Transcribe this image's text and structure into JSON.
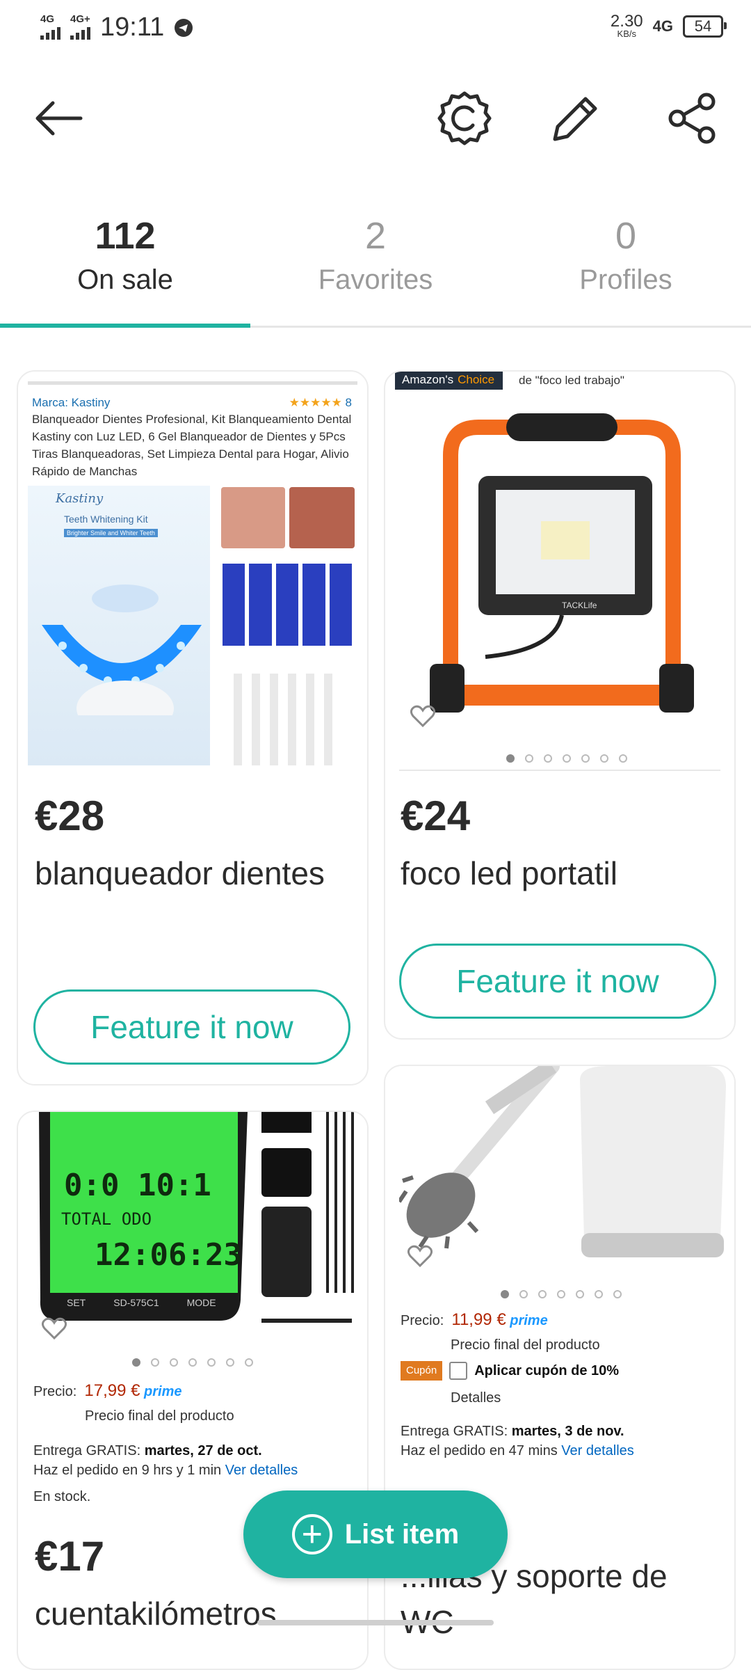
{
  "status_bar": {
    "network1": "4G",
    "network2": "4G+",
    "time": "19:11",
    "speed_value": "2.30",
    "speed_unit": "KB/s",
    "network_right": "4G",
    "battery": "54"
  },
  "header": {
    "back_icon": "arrow-left-icon",
    "boost_icon": "badge-gear-icon",
    "edit_icon": "pencil-icon",
    "share_icon": "share-icon"
  },
  "tabs": [
    {
      "count": "112",
      "label": "On sale"
    },
    {
      "count": "2",
      "label": "Favorites"
    },
    {
      "count": "0",
      "label": "Profiles"
    }
  ],
  "listings": [
    {
      "price": "€28",
      "title": "blanqueador dientes",
      "button": "Feature it now",
      "image_text": {
        "brand": "Marca: Kastiny",
        "rating_count": "8",
        "description": "Blanqueador Dientes Profesional, Kit Blanqueamiento Dental Kastiny con Luz LED, 6 Gel Blanqueador de Dientes y 5Pcs Tiras Blanqueadoras, Set Limpieza Dental para Hogar, Alivio Rápido de Manchas",
        "logo": "Kastiny",
        "kit_label": "Teeth Whitening Kit",
        "kit_sub": "Brighter Smile and Whiter Teeth"
      }
    },
    {
      "price": "€24",
      "title": "foco led portatil",
      "button": "Feature it now",
      "image_text": {
        "badge_left": "Amazon's",
        "badge_right": "Choice",
        "badge_for": "de \"foco led trabajo\"",
        "brand": "TACKLife"
      }
    },
    {
      "price": "€17",
      "title": "cuentakilómetros",
      "image_text": {
        "display_line1": "0:0 10:1",
        "display_line2": "TOTAL ODO",
        "display_line3": "12:06:23",
        "btn_set": "SET",
        "model": "SD-575C1",
        "btn_mode": "MODE",
        "price_label": "Precio:",
        "price": "17,99 €",
        "prime": "prime",
        "final_price": "Precio final del producto",
        "delivery": "Entrega GRATIS:",
        "delivery_date": "martes, 27 de oct.",
        "order_hint": "Haz el pedido en 9 hrs y 1 min",
        "details_link": "Ver detalles",
        "stock": "En stock."
      }
    },
    {
      "price": "",
      "title": "...illas y soporte de WC",
      "image_text": {
        "price_label": "Precio:",
        "price": "11,99 €",
        "prime": "prime",
        "final_price": "Precio final del producto",
        "coupon_badge": "Cupón",
        "coupon_text": "Aplicar cupón de 10%",
        "details": "Detalles",
        "delivery": "Entrega GRATIS:",
        "delivery_date": "martes, 3 de nov.",
        "order_hint": "Haz el pedido en 47 mins",
        "details_link": "Ver detalles"
      }
    }
  ],
  "fab": {
    "label": "List item",
    "icon": "plus-circle-icon"
  },
  "colors": {
    "accent": "#1fb3a1",
    "text": "#2b2b2b",
    "muted": "#9a9a9a",
    "amazon_price": "#b12704"
  }
}
